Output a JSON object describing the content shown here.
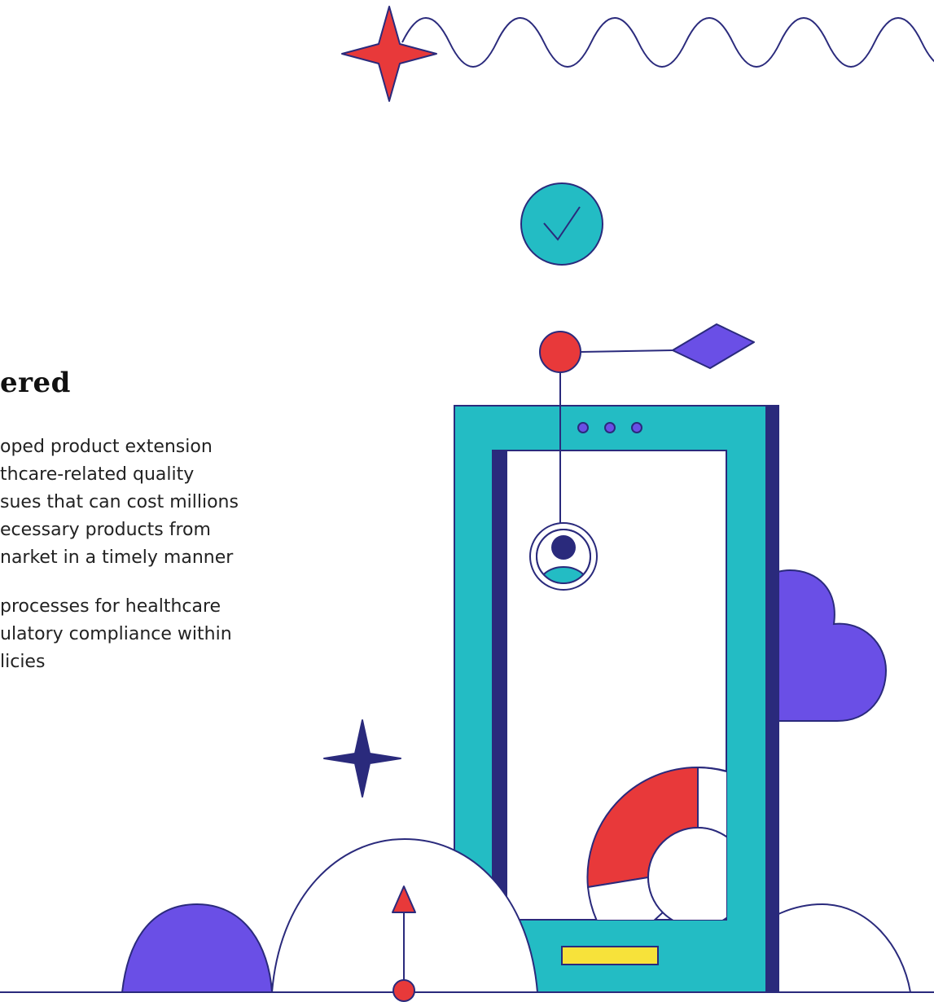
{
  "section": {
    "heading": "ered",
    "paragraph_1": [
      "oped product extension",
      "thcare-related quality",
      "sues that can cost millions",
      "ecessary products from",
      "narket in a timely manner"
    ],
    "paragraph_2": [
      "processes for healthcare",
      "ulatory compliance within",
      "licies"
    ]
  },
  "colors": {
    "navy": "#2a2a7c",
    "teal": "#23bcc4",
    "purple": "#6a4fe6",
    "red": "#e8393a",
    "yellow": "#f7e23a",
    "white": "#ffffff"
  },
  "icons": [
    "red-sparkle-icon",
    "wave-line-icon",
    "checkmark-circle-icon",
    "pin-dot-icon",
    "purple-diamond-icon",
    "phone-device-icon",
    "user-avatar-icon",
    "cloud-icon",
    "donut-chart-icon",
    "navy-sparkle-icon",
    "hill-dome-icon",
    "up-arrow-icon"
  ]
}
